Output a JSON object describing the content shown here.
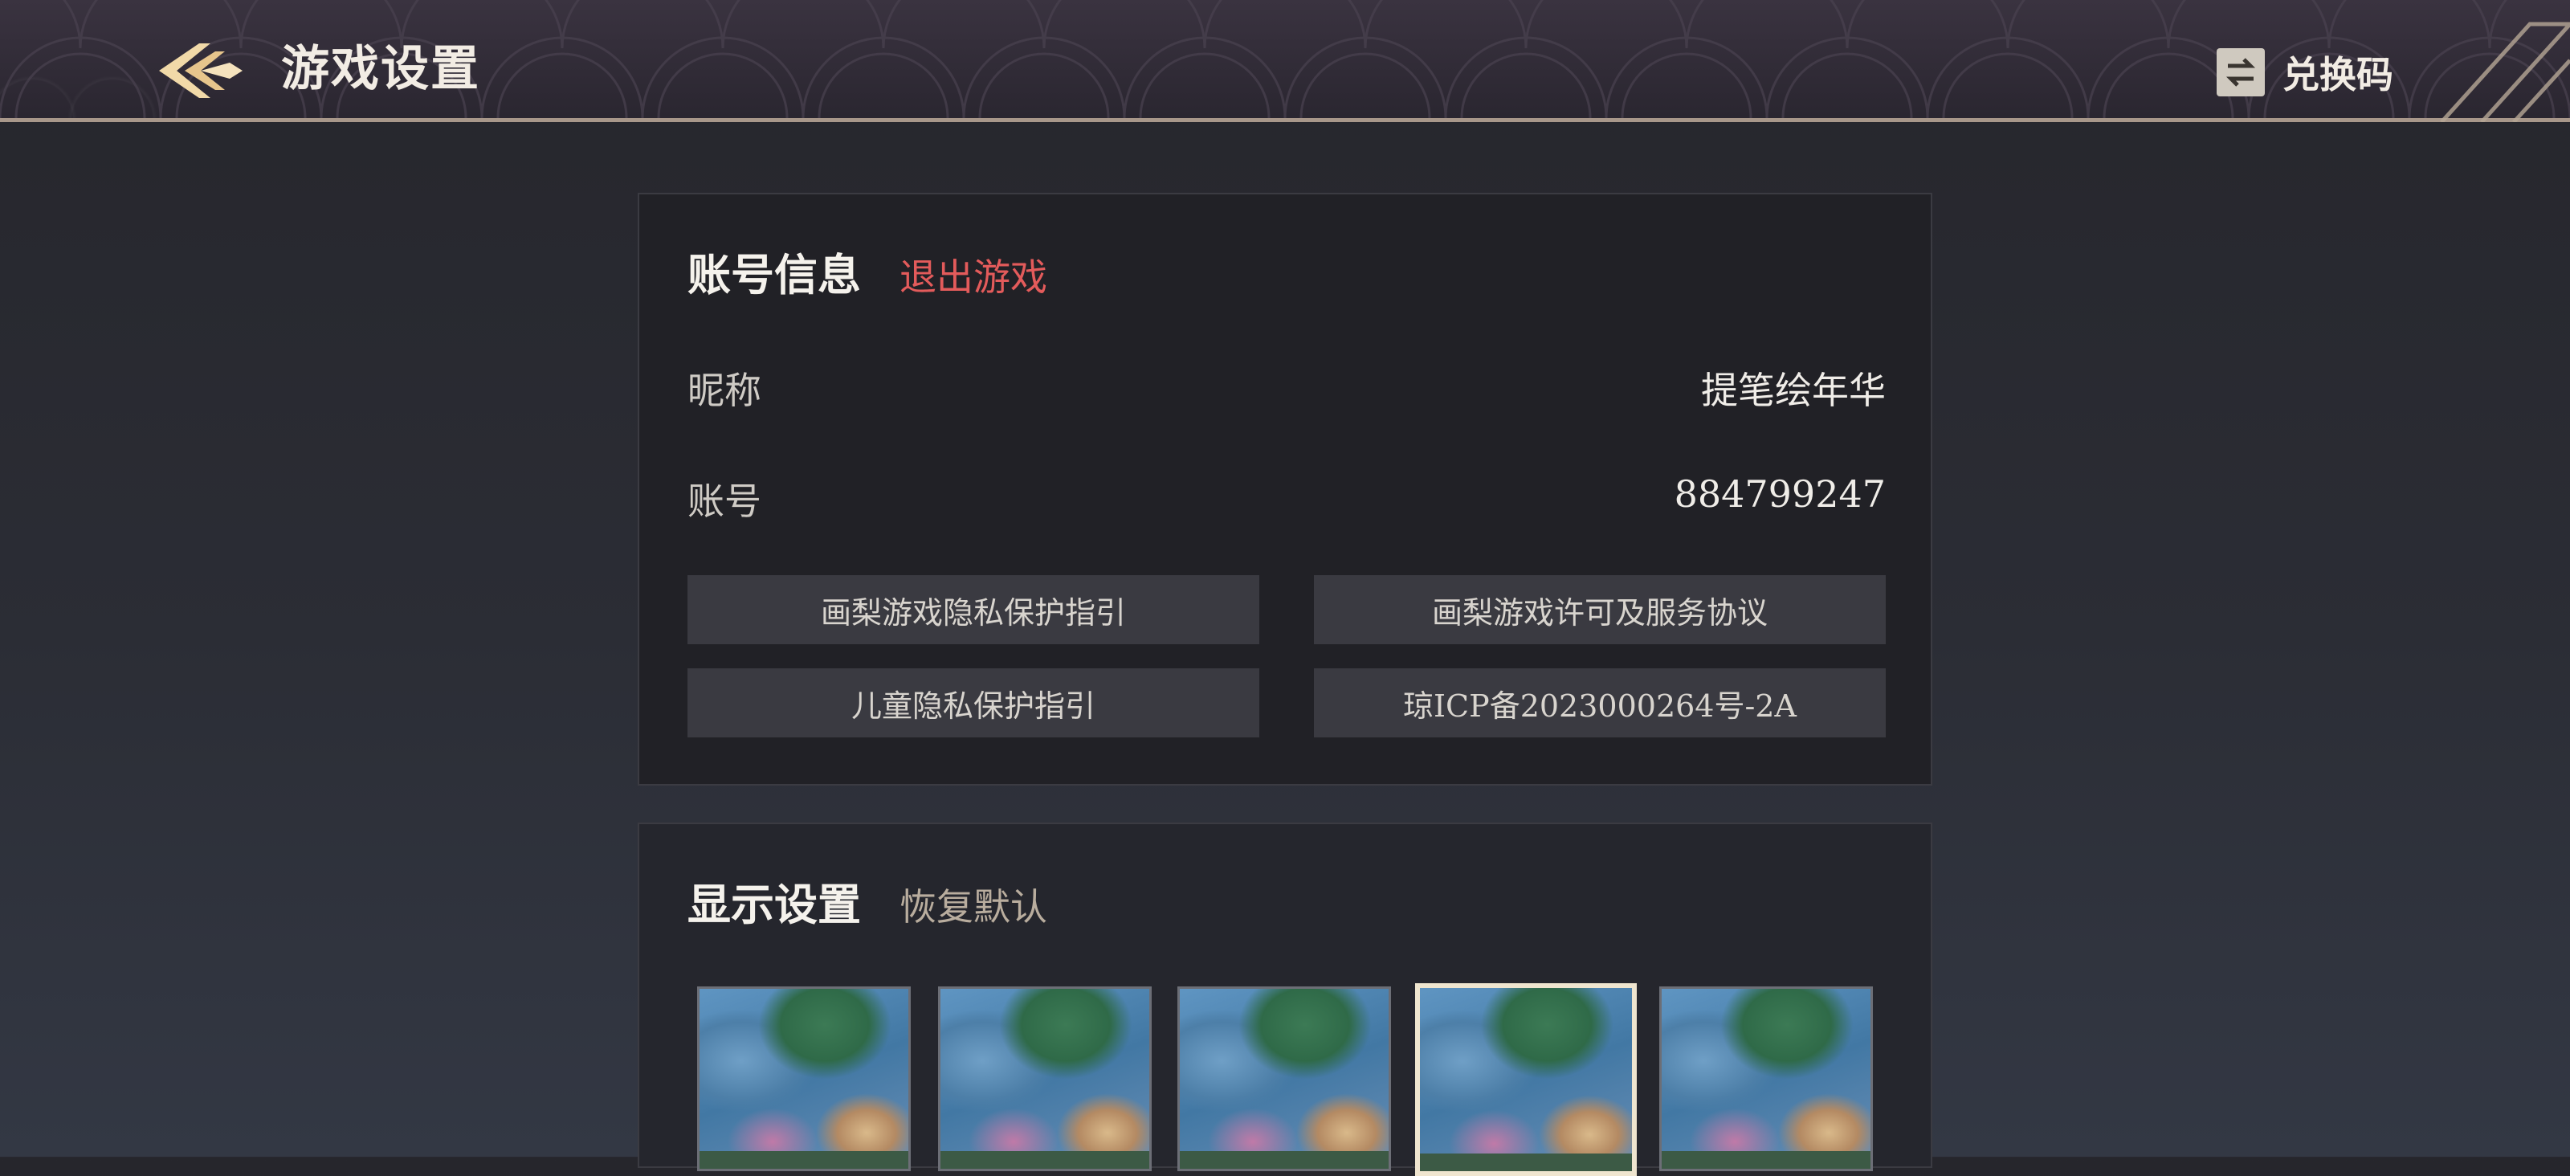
{
  "header": {
    "title": "游戏设置",
    "redeem_label": "兑换码"
  },
  "account": {
    "title": "账号信息",
    "logout_label": "退出游戏",
    "nickname_label": "昵称",
    "nickname_value": "提笔绘年华",
    "account_label": "账号",
    "account_value": "884799247",
    "links": [
      "画梨游戏隐私保护指引",
      "画梨游戏许可及服务协议",
      "儿童隐私保护指引",
      "琼ICP备2023000264号-2A"
    ]
  },
  "display": {
    "title": "显示设置",
    "reset_label": "恢复默认",
    "selected_thumbnail": 4
  },
  "colors": {
    "accent_red": "#e35b5b",
    "accent_beige": "#b9ad9e",
    "header_border": "#a8978a"
  }
}
